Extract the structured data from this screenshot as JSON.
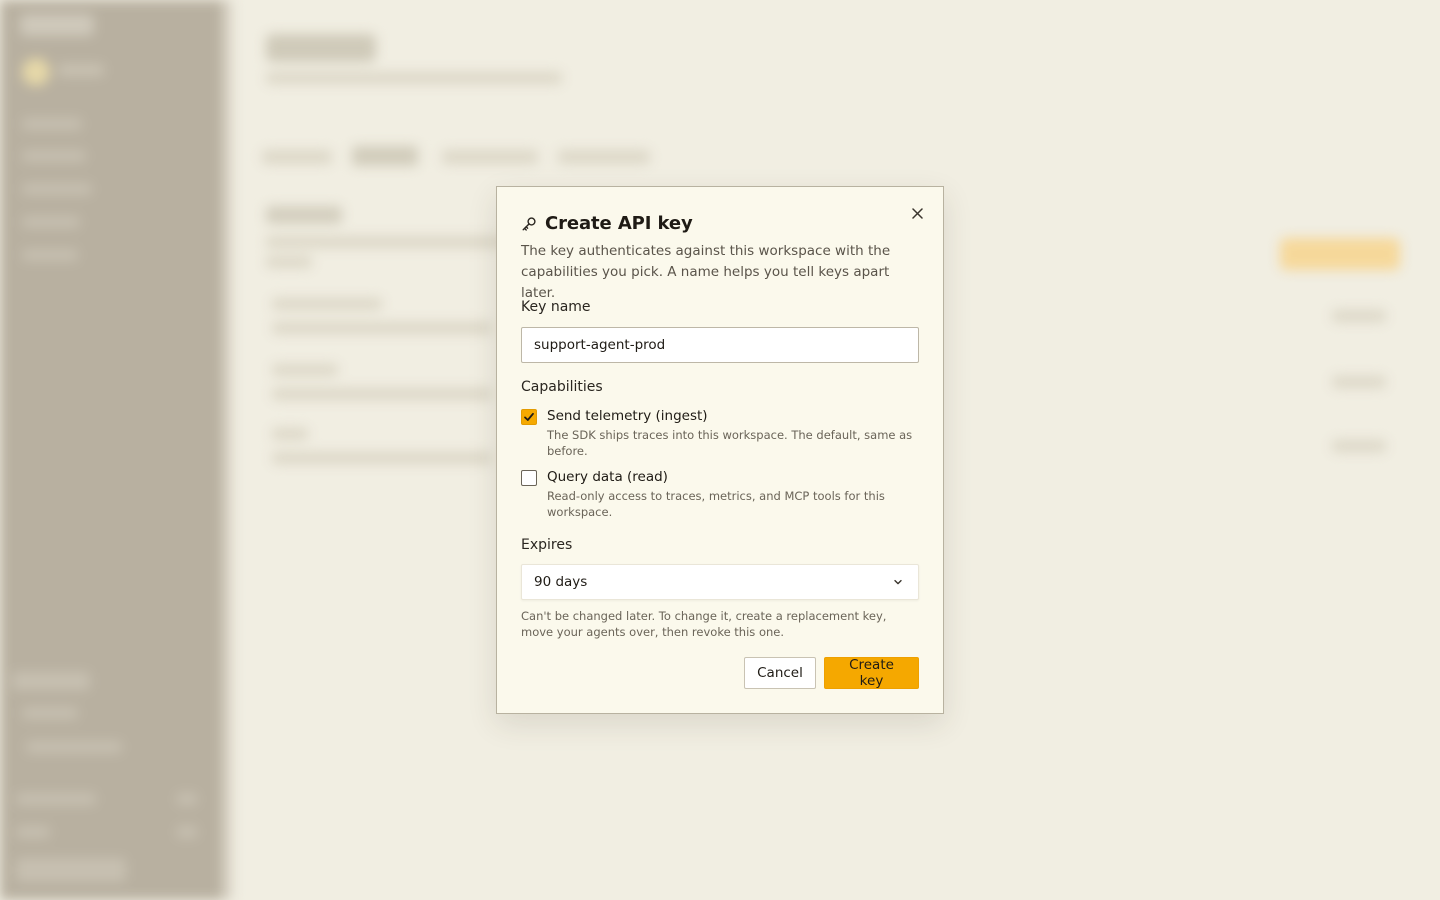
{
  "modal": {
    "title": "Create API key",
    "description": "The key authenticates against this workspace with the capabilities you pick. A name helps you tell keys apart later.",
    "key_name": {
      "label": "Key name",
      "value": "support-agent-prod"
    },
    "capabilities": {
      "label": "Capabilities",
      "items": [
        {
          "title": "Send telemetry (ingest)",
          "help": "The SDK ships traces into this workspace. The default, same as before.",
          "checked": true
        },
        {
          "title": "Query data (read)",
          "help": "Read-only access to traces, metrics, and MCP tools for this workspace.",
          "checked": false
        }
      ]
    },
    "expires": {
      "label": "Expires",
      "selected": "90 days",
      "help": "Can't be changed later. To change it, create a replacement key, move your agents over, then revoke this one."
    },
    "buttons": {
      "cancel": "Cancel",
      "create": "Create key"
    },
    "icons": {
      "title": "key-icon",
      "close": "close-icon",
      "select": "chevron-down-icon",
      "check": "checkmark-icon"
    }
  },
  "colors": {
    "page_bg": "#f1eee2",
    "modal_bg": "#fbf9ec",
    "accent": "#f5a800",
    "sidebar_bg": "#b8b0a0"
  }
}
